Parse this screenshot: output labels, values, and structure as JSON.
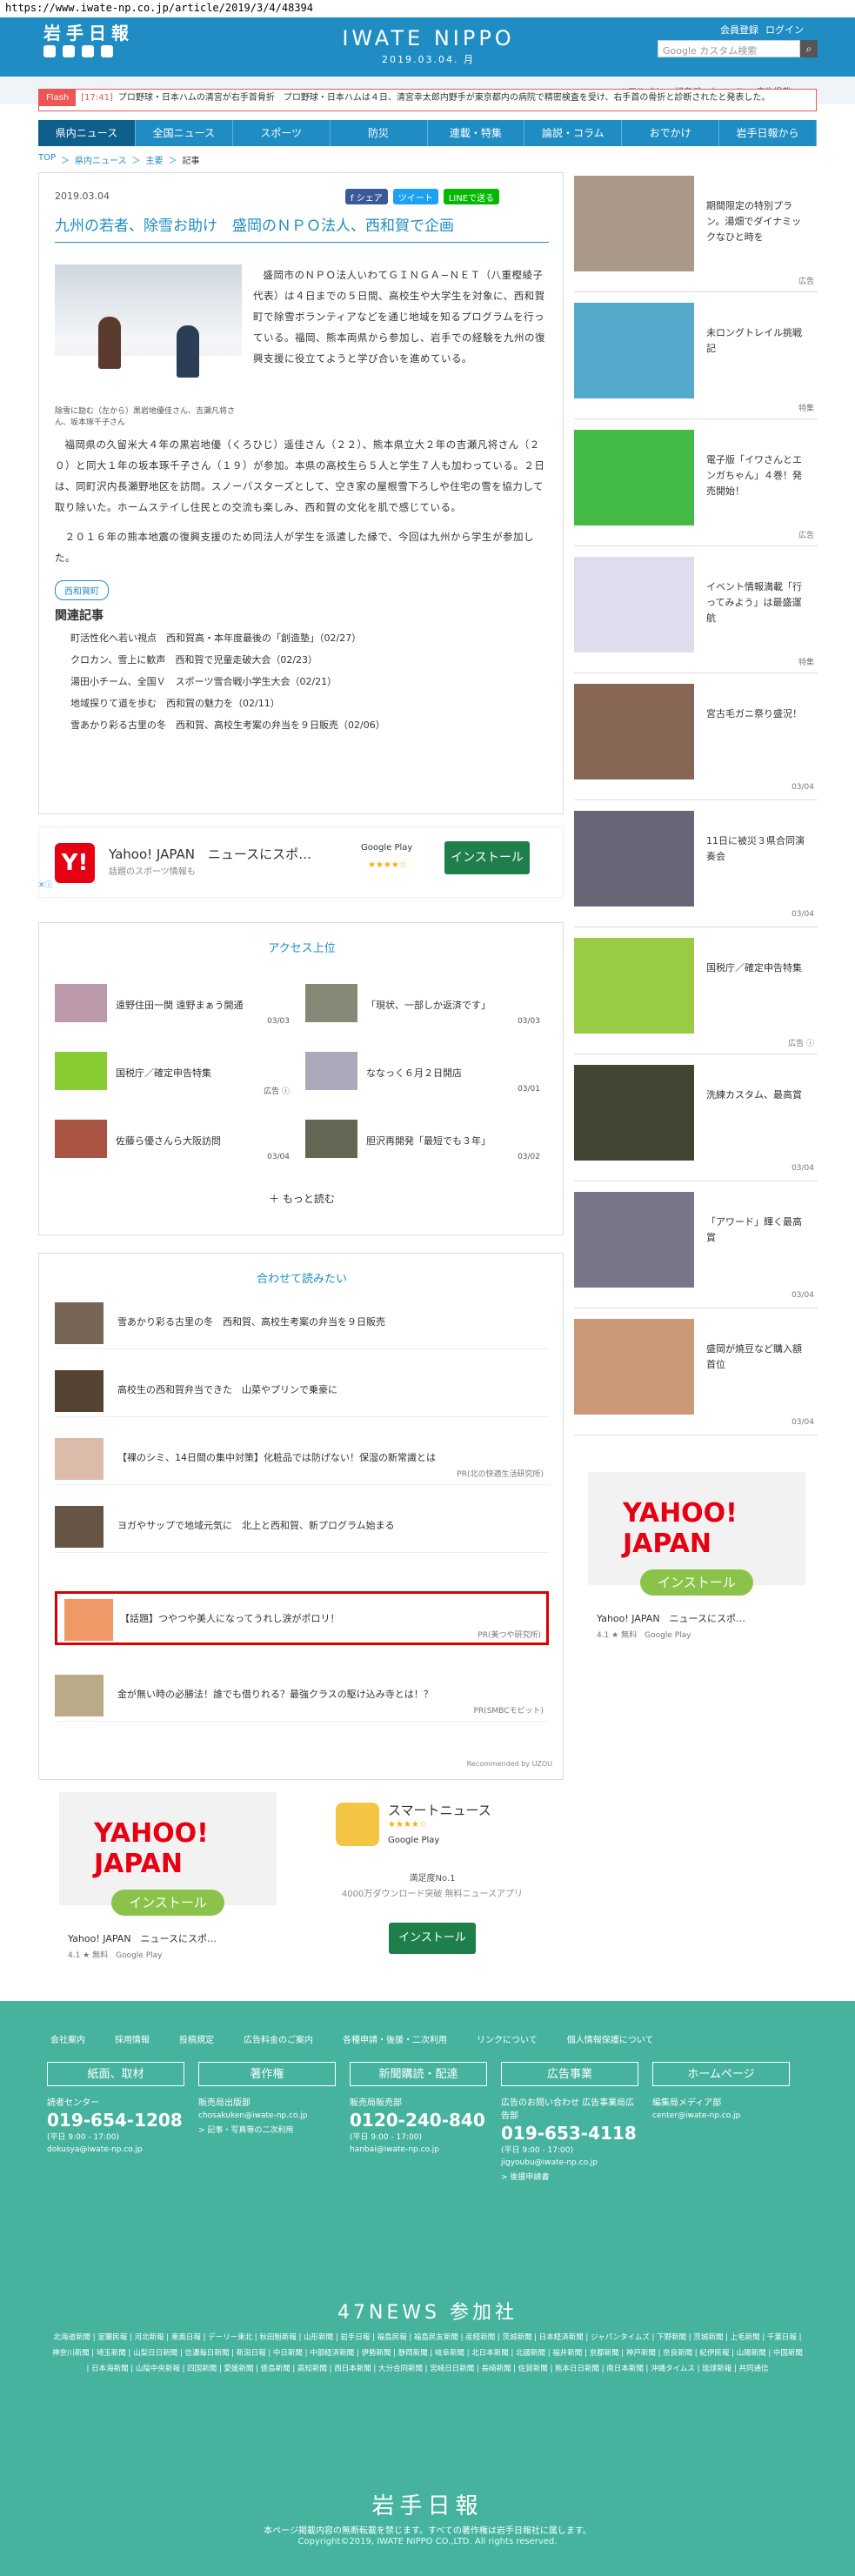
{
  "url": "https://www.iwate-np.co.jp/article/2019/3/4/48394",
  "header": {
    "logo": "岩手日報",
    "brand": "IWATE NIPPO",
    "date": "2019.03.04. 月",
    "member_link": "会員登録",
    "login_link": "ログイン",
    "search_placeholder": "Google カスタム検索"
  },
  "subnav": [
    "Webアルバム",
    "記者データベース",
    "広告掲載"
  ],
  "flash": {
    "tag": "Flash",
    "time": "[17:41]",
    "items": [
      "プロ野球・日本ハムの清宮が右手首骨折",
      "プロ野球・日本ハムは４日、清宮幸太郎内野手が東京都内の病院で精密検査を受け、右手首の骨折と診断されたと発表した。"
    ]
  },
  "mainnav": [
    "県内ニュース",
    "全国ニュース",
    "スポーツ",
    "防災",
    "連載・特集",
    "論説・コラム",
    "おでかけ",
    "岩手日報から"
  ],
  "breadcrumb": [
    "TOP",
    "県内ニュース",
    "主要",
    "記事"
  ],
  "article": {
    "date": "2019.03.04",
    "share": [
      "f シェア",
      "ツイート",
      "LINEで送る"
    ],
    "title": "九州の若者、除雪お助け　盛岡のＮＰＯ法人、西和賀で企画",
    "caption": "除雪に励む（左から）黒岩地優佳さん、吉瀬凡将さん、坂本琢千子さん",
    "para1": "盛岡市のＮＰＯ法人いわてＧＩＮＧＡ−ＮＥＴ（八重樫綾子代表）は４日までの５日間、高校生や大学生を対象に、西和賀町で除雪ボランティアなどを通じ地域を知るプログラムを行っている。福岡、熊本両県から参加し、岩手での経験を九州の復興支援に役立てようと学び合いを進めている。",
    "para2": "福岡県の久留米大４年の黒岩地優（くろひじ）遥佳さん（２２）、熊本県立大２年の吉瀬凡将さん（２０）と同大１年の坂本琢千子さん（１９）が参加。本県の高校生ら５人と学生７人も加わっている。２日は、同町沢内長瀬野地区を訪問。スノーバスターズとして、空き家の屋根雪下ろしや住宅の雪を協力して取り除いた。ホームステイし住民との交流も楽しみ、西和賀の文化を肌で感じている。",
    "para3": "２０１６年の熊本地震の復興支援のため同法人が学生を派遣した縁で、今回は九州から学生が参加した。",
    "tag": "西和賀町",
    "related_heading": "関連記事",
    "related": [
      "町活性化へ若い視点　西和賀高・本年度最後の「創造塾」（02/27）",
      "クロカン、雪上に歓声　西和賀で児童走破大会（02/23）",
      "湯田小チーム、全国Ｖ　スポーツ雪合戦小学生大会（02/21）",
      "地域探りて道を歩む　西和賀の魅力を（02/11）",
      "雪あかり彩る古里の冬　西和賀、高校生考案の弁当を９日販売（02/06）"
    ]
  },
  "yahoo_ad": {
    "logo": "Y!",
    "title": "Yahoo! JAPAN　ニュースにスポ…",
    "sub": "話題のスポーツ情報も",
    "store": "Google Play",
    "stars": "★★★★☆",
    "install": "インストール",
    "badge": "✕ⓘ"
  },
  "access": {
    "heading": "アクセス上位",
    "items": [
      {
        "title": "遠野住田一関 遠野まぁう開通",
        "date": "03/03"
      },
      {
        "title": "「現状、一部しか返済です」",
        "date": "03/03"
      },
      {
        "title": "国税庁／確定申告特集",
        "date": "広告 ⓘ"
      },
      {
        "title": "ななっく６月２日開店",
        "date": "03/01"
      },
      {
        "title": "佐藤ら優さんら大阪訪問",
        "date": "03/04"
      },
      {
        "title": "胆沢再開発「最短でも３年」",
        "date": "03/02"
      }
    ],
    "more": "＋ もっと読む"
  },
  "recommend": {
    "heading": "合わせて読みたい",
    "items": [
      {
        "title": "雪あかり彩る古里の冬　西和賀、高校生考案の弁当を９日販売",
        "pr": ""
      },
      {
        "title": "高校生の西和賀弁当できた　山菜やプリンで乗豪に",
        "pr": ""
      },
      {
        "title": "【裸のシミ、14日間の集中対策】化粧品では防げない！保湿の新常識とは",
        "pr": "PR(北の快適生活研究所)"
      },
      {
        "title": "ヨガやサップで地域元気に　北上と西和賀、新プログラム始まる",
        "pr": ""
      },
      {
        "title": "【話題】つやつや美人になってうれし涙がポロリ！",
        "pr": "PR(美つや研究所)"
      },
      {
        "title": "金が無い時の必勝法！誰でも借りれる？最強クラスの駆け込み寺とは！？",
        "pr": "PR(SMBCモビット)"
      }
    ],
    "by": "Recommended by UZOU"
  },
  "bottom_ads": {
    "yahoo": {
      "logo": "YAHOO! JAPAN",
      "install": "インストール",
      "title": "Yahoo! JAPAN　ニュースにスポ…",
      "meta": "4.1 ★ 無料　Google Play"
    },
    "smart": {
      "title": "スマートニュース",
      "stars": "★★★★☆",
      "store": "Google Play",
      "line1": "満足度No.1",
      "line2": "4000万ダウンロード突破 無料ニュースアプリ",
      "install": "インストール"
    }
  },
  "sidebar": [
    {
      "title": "期間限定の特別プラン。湯畑でダイナミックなひと時を",
      "date": "広告"
    },
    {
      "title": "未ロングトレイル挑戦記",
      "date": "特集"
    },
    {
      "title": "電子版「イワさんとエンガちゃん」４巻！発売開始！",
      "date": "広告"
    },
    {
      "title": "イベント情報満載「行ってみよう」は最盛運航",
      "date": "特集"
    },
    {
      "title": "宮古毛ガニ祭り盛況！",
      "date": "03/04"
    },
    {
      "title": "11日に被災３県合同演奏会",
      "date": "03/04"
    },
    {
      "title": "国税庁／確定申告特集",
      "date": "広告 ⓘ"
    },
    {
      "title": "洗練カスタム、最高賞",
      "date": "03/04"
    },
    {
      "title": "「アワード」輝く最高賞",
      "date": "03/04"
    },
    {
      "title": "盛岡が焼豆など購入額首位",
      "date": "03/04"
    }
  ],
  "side_ad": {
    "logo": "YAHOO! JAPAN",
    "install": "インストール",
    "title": "Yahoo! JAPAN　ニュースにスポ…",
    "meta": "4.1 ★ 無料　Google Play"
  },
  "footer": {
    "links": [
      "会社案内",
      "採用情報",
      "投稿規定",
      "広告料金のご案内",
      "各種申請・後援・二次利用",
      "リンクについて",
      "個人情報保護について"
    ],
    "boxes": [
      {
        "head": "紙面、取材",
        "label": "読者センター",
        "tel": "019-654-1208",
        "hours": "(平日 9:00 - 17:00)",
        "mail": "dokusya@iwate-np.co.jp",
        "extra": ""
      },
      {
        "head": "著作権",
        "label": "販売局出版部",
        "tel": "",
        "hours": "",
        "mail": "chosakuken@iwate-np.co.jp",
        "extra": "> 記事・写真等の二次利用"
      },
      {
        "head": "新聞購読・配達",
        "label": "販売局販売部",
        "tel": "0120-240-840",
        "hours": "(平日 9:00 - 17:00)",
        "mail": "hanbai@iwate-np.co.jp",
        "extra": ""
      },
      {
        "head": "広告事業",
        "label": "広告のお問い合わせ 広告事業局広告部",
        "tel": "019-653-4118",
        "hours": "(平日 9:00 - 17:00)",
        "mail": "jigyoubu@iwate-np.co.jp",
        "extra": "> 後援申請書"
      },
      {
        "head": "ホームページ",
        "label": "編集局メディア部",
        "tel": "",
        "hours": "",
        "mail": "center@iwate-np.co.jp",
        "extra": ""
      }
    ],
    "news47": "47NEWS 参加社",
    "papers": "北海道新聞 | 室蘭民報 | 河北新報 | 東奥日報 | デーリー東北 | 秋田魁新報 | 山形新聞 | 岩手日報 | 福島民報 | 福島民友新聞 | 産経新聞 | 茨城新聞 | 日本経済新聞 | ジャパンタイムズ | 下野新聞 | 茨城新聞 | 上毛新聞 | 千葉日報 | 神奈川新聞 | 埼玉新聞 | 山梨日日新聞 | 信濃毎日新聞 | 新潟日報 | 中日新聞 | 中部経済新聞 | 伊勢新聞 | 静岡新聞 | 岐阜新聞 | 北日本新聞 | 北國新聞 | 福井新聞 | 京都新聞 | 神戸新聞 | 奈良新聞 | 紀伊民報 | 山陽新聞 | 中国新聞 | 日本海新聞 | 山陰中央新報 | 四国新聞 | 愛媛新聞 | 徳島新聞 | 高知新聞 | 西日本新聞 | 大分合同新聞 | 宮崎日日新聞 | 長崎新聞 | 佐賀新聞 | 熊本日日新聞 | 南日本新聞 | 沖縄タイムス | 琉球新報 | 共同通信",
    "logo": "岩手日報",
    "note": "本ページ掲載内容の無断転載を禁じます。すべての著作権は岩手日報社に属します。",
    "copyright": "Copyright©2019, IWATE NIPPO CO.,LTD. All rights reserved."
  }
}
